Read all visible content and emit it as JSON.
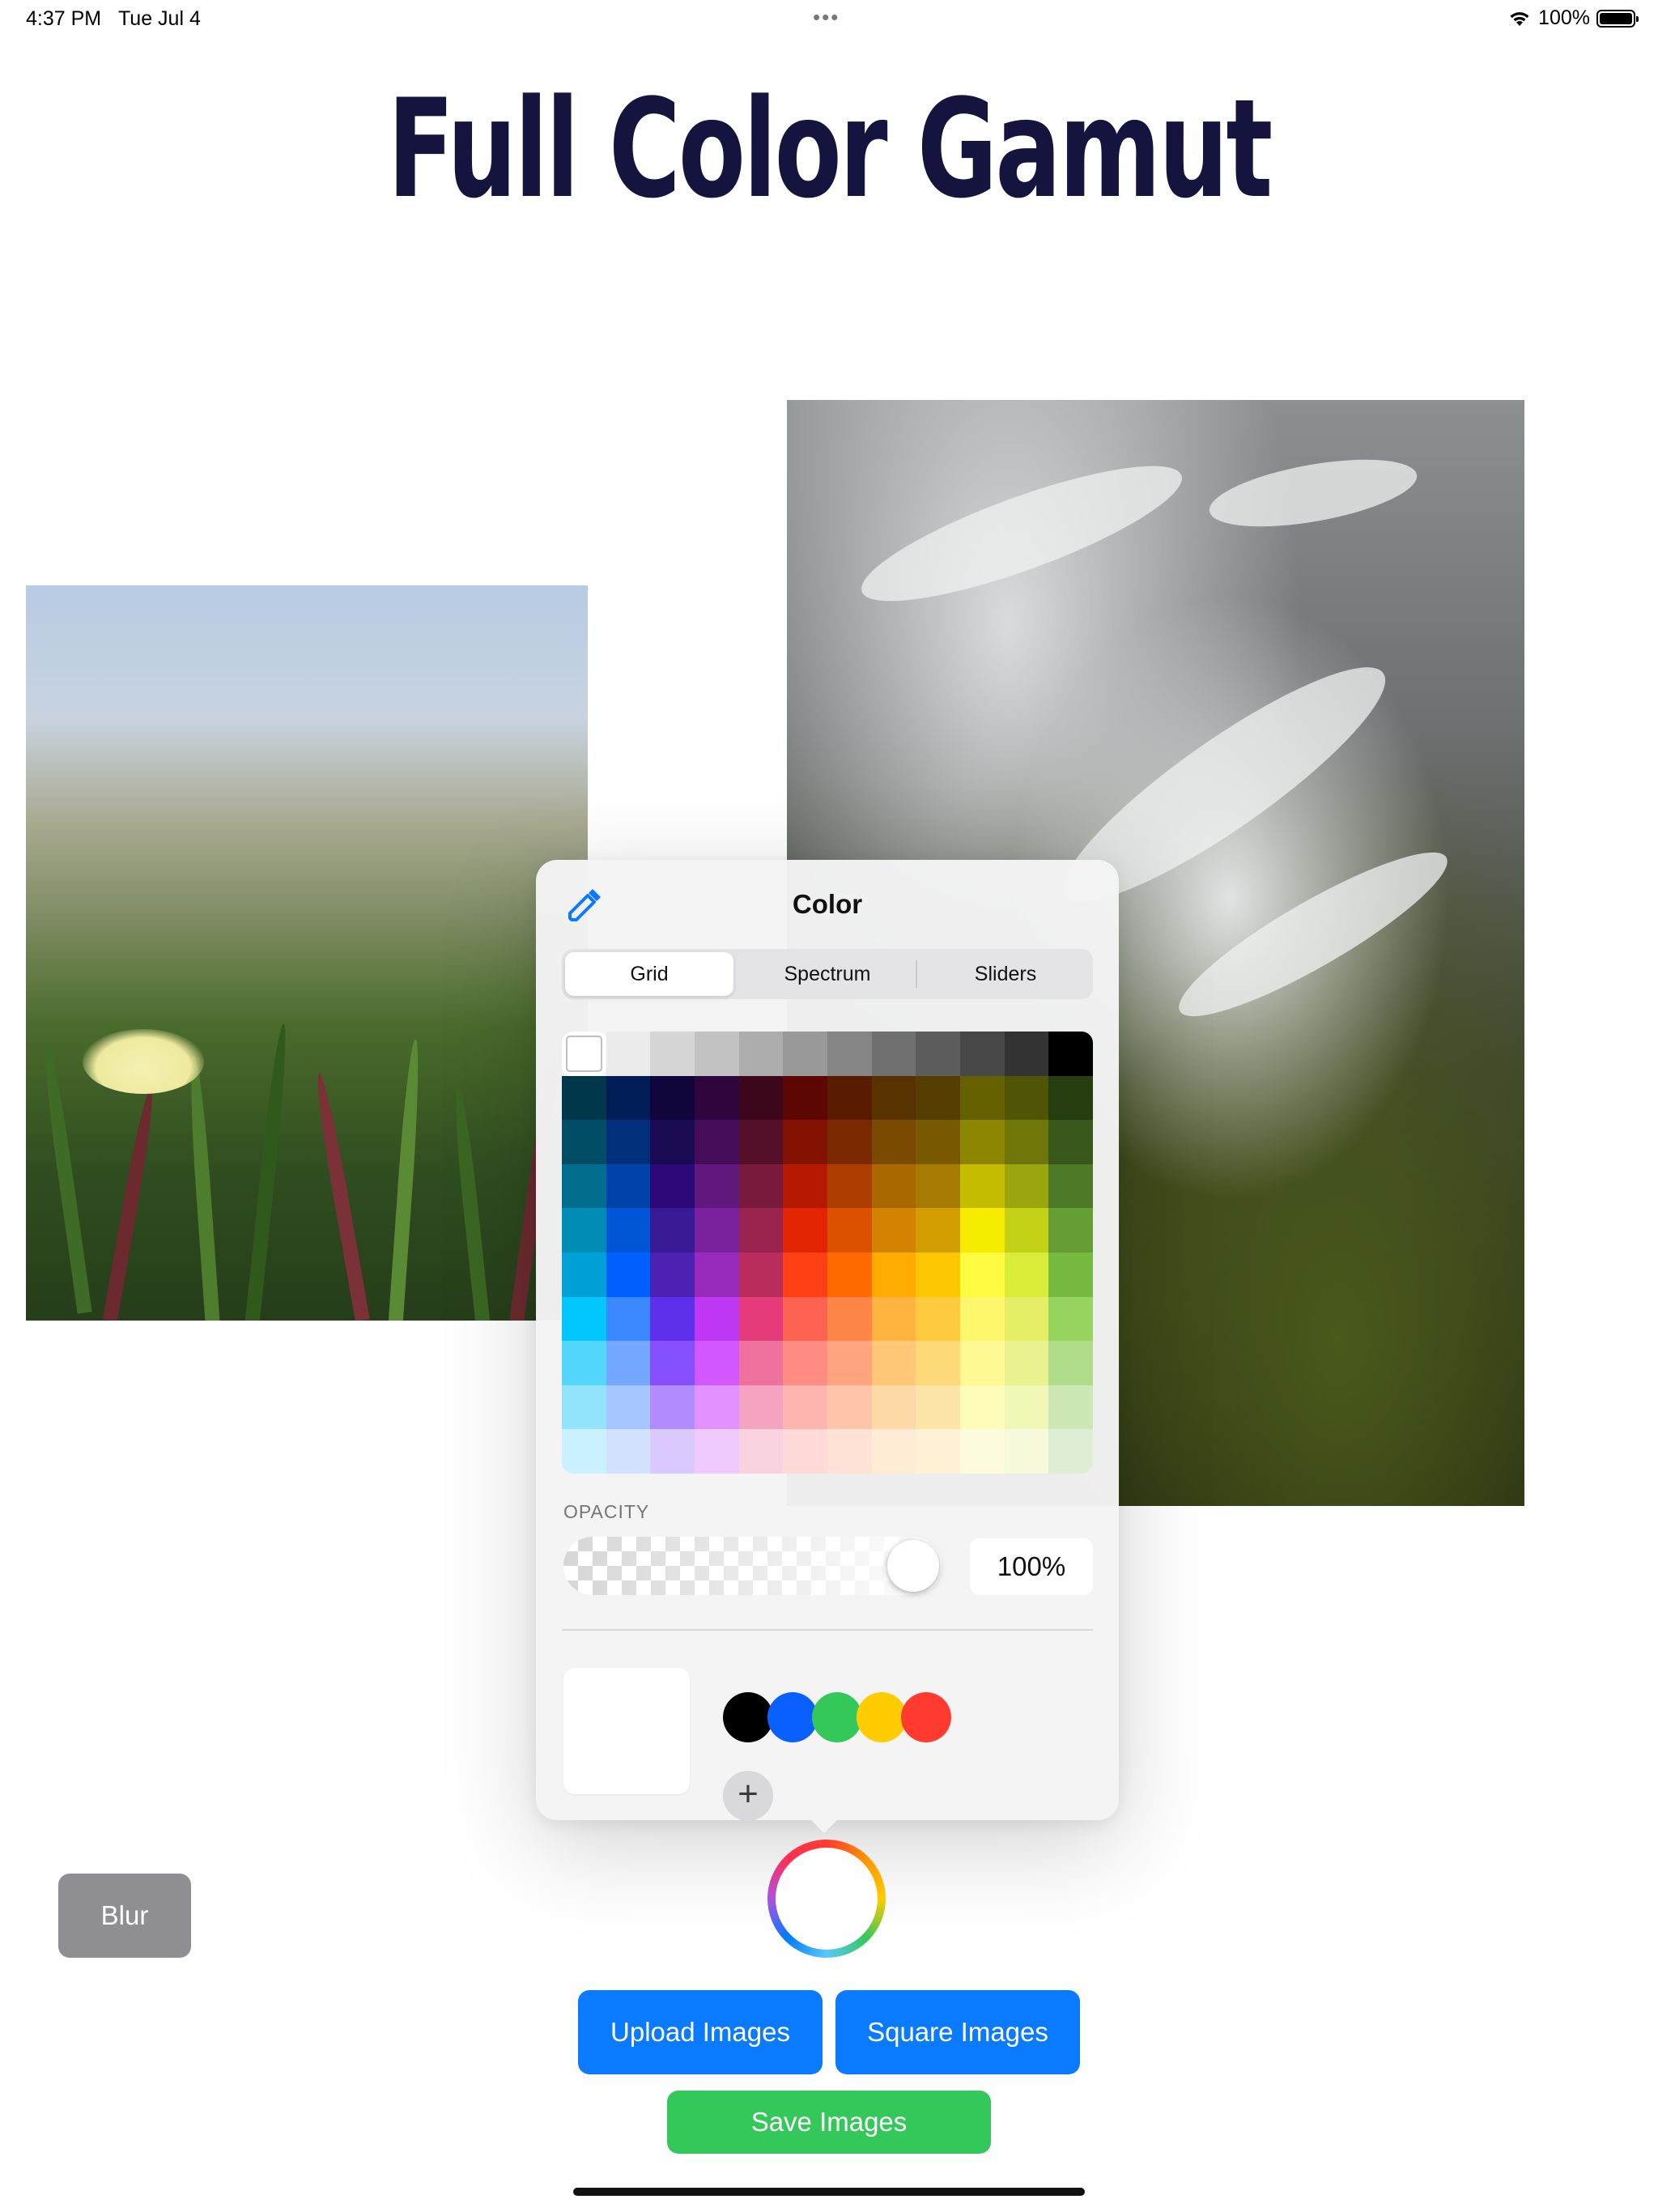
{
  "status_bar": {
    "time": "4:37 PM",
    "date": "Tue Jul 4",
    "dots": "•••",
    "battery_percent": "100%",
    "battery_level": 1.0
  },
  "page": {
    "title": "Full Color Gamut"
  },
  "color_picker": {
    "title": "Color",
    "tabs": [
      {
        "label": "Grid",
        "active": true
      },
      {
        "label": "Spectrum",
        "active": false
      },
      {
        "label": "Sliders",
        "active": false
      }
    ],
    "opacity_label": "OPACITY",
    "opacity_value": "100%",
    "opacity_level": 1.0,
    "current_color": "#ffffff",
    "favorite_colors": [
      "#000000",
      "#0a60ff",
      "#34c759",
      "#ffcc00",
      "#ff3b30"
    ],
    "add_label": "+",
    "grid_colors": [
      [
        "#ffffff",
        "#ebebeb",
        "#d6d6d6",
        "#c2c2c2",
        "#adadad",
        "#999999",
        "#858585",
        "#707070",
        "#5c5c5c",
        "#474747",
        "#333333",
        "#000000"
      ],
      [
        "#00374a",
        "#011d57",
        "#11053b",
        "#2e063d",
        "#3c071b",
        "#5c0701",
        "#5a1c00",
        "#583300",
        "#563d00",
        "#666100",
        "#4f5504",
        "#263e0f"
      ],
      [
        "#004d65",
        "#012f7b",
        "#1a0a52",
        "#450d59",
        "#551029",
        "#831100",
        "#7b2900",
        "#7a4a00",
        "#785800",
        "#8c8602",
        "#6f760a",
        "#38571a"
      ],
      [
        "#016e8f",
        "#0042a9",
        "#2c0977",
        "#61187c",
        "#791a3d",
        "#b51a00",
        "#ad3e00",
        "#a96800",
        "#a67b01",
        "#c4bc00",
        "#9ba50e",
        "#4e7a27"
      ],
      [
        "#008cb4",
        "#0056d6",
        "#371a94",
        "#7a219e",
        "#99244f",
        "#e22400",
        "#da5100",
        "#d38301",
        "#d19d01",
        "#f5ec00",
        "#c3d117",
        "#669d34"
      ],
      [
        "#00a1d8",
        "#0061fe",
        "#4d22b2",
        "#982abc",
        "#b92d5d",
        "#ff4015",
        "#ff6a00",
        "#ffab01",
        "#fdc700",
        "#fefb41",
        "#d9ec37",
        "#76bb40"
      ],
      [
        "#01c7fc",
        "#3a87fe",
        "#5e30eb",
        "#be38f3",
        "#e63b7a",
        "#fe6250",
        "#fe8648",
        "#feb43f",
        "#fecb3e",
        "#fff76b",
        "#e4ef65",
        "#96d35f"
      ],
      [
        "#52d6fc",
        "#74a7ff",
        "#864ffe",
        "#d357fe",
        "#ee719e",
        "#ff8c82",
        "#fea57d",
        "#ffc777",
        "#fed977",
        "#fff994",
        "#eaf28f",
        "#b1dd8b"
      ],
      [
        "#93e3fc",
        "#a7c6ff",
        "#b18cfe",
        "#e292fe",
        "#f4a4c0",
        "#ffb5af",
        "#ffc5ab",
        "#fed9a8",
        "#fde4a8",
        "#fffbb9",
        "#f1f7b7",
        "#cde8b5"
      ],
      [
        "#cbf0ff",
        "#d3e2ff",
        "#d9c9fe",
        "#efcaff",
        "#f9d3e0",
        "#ffdad8",
        "#ffe2d6",
        "#feecd4",
        "#fef1d5",
        "#fdfbdd",
        "#f6fadb",
        "#deeed4"
      ]
    ]
  },
  "buttons": {
    "blur": "Blur",
    "upload": "Upload Images",
    "square": "Square Images",
    "save": "Save Images"
  },
  "colors": {
    "title": "#14143f",
    "blue_button": "#0a7aff",
    "green_button": "#34c759",
    "gray_button": "#8e8e93"
  },
  "icons": {
    "eyedropper": "eyedropper-icon",
    "wifi": "wifi-icon",
    "battery": "battery-icon",
    "color_well": "color-wheel-icon"
  }
}
